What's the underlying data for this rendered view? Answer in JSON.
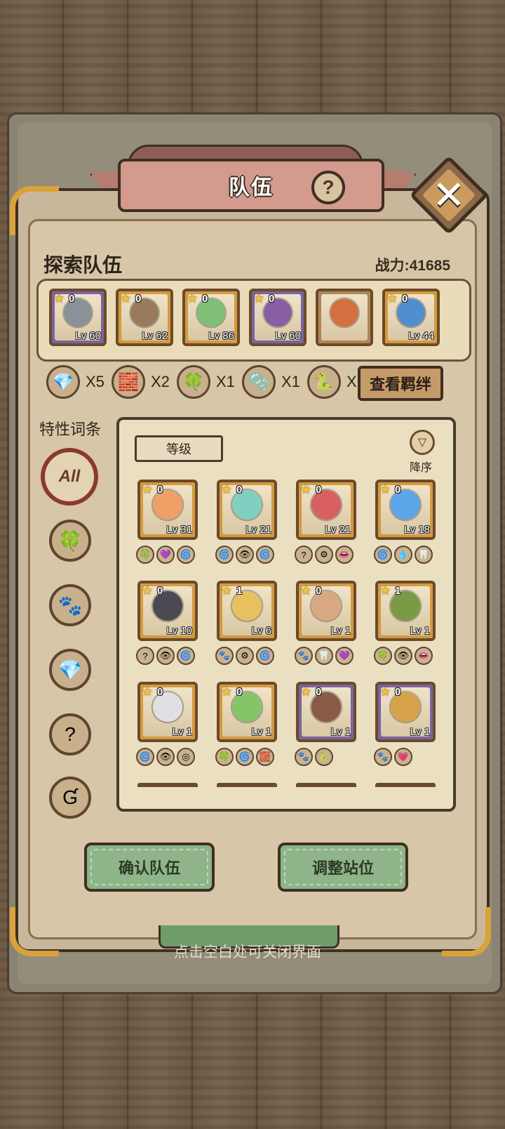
{
  "header": {
    "title": "队伍",
    "help_icon": "question-icon",
    "close_icon": "close-x-icon"
  },
  "team": {
    "title": "探索队伍",
    "power": "战力:41685",
    "members": [
      {
        "stars": "0",
        "level": "Lv 60",
        "frame": "purple",
        "color": "#8b9199"
      },
      {
        "stars": "0",
        "level": "Lv 62",
        "frame": "gold",
        "color": "#9a7a5c"
      },
      {
        "stars": "0",
        "level": "Lv 86",
        "frame": "gold",
        "color": "#7fbf76"
      },
      {
        "stars": "0",
        "level": "Lv 60",
        "frame": "purple",
        "color": "#8a5ea5"
      },
      {
        "stars": "",
        "level": "",
        "frame": "brown",
        "color": "#d4703f"
      },
      {
        "stars": "0",
        "level": "Lv 44",
        "frame": "gold",
        "color": "#4f8fd0"
      }
    ]
  },
  "bonds": {
    "items": [
      {
        "icon": "crystal-icon",
        "count": "X5"
      },
      {
        "icon": "blocks-icon",
        "count": "X2"
      },
      {
        "icon": "leaf-icon",
        "count": "X1"
      },
      {
        "icon": "slime-icon",
        "count": "X1"
      },
      {
        "icon": "worm-icon",
        "count": "X"
      }
    ],
    "view_button": "查看羁绊"
  },
  "filters": {
    "title": "特性词条",
    "items": [
      {
        "label": "All",
        "icon": "all-icon"
      },
      {
        "label": "",
        "icon": "leaf-icon"
      },
      {
        "label": "",
        "icon": "paw-icon"
      },
      {
        "label": "",
        "icon": "crystal-icon"
      },
      {
        "label": "?",
        "icon": "question-icon"
      },
      {
        "label": "",
        "icon": "g-rune-icon"
      }
    ]
  },
  "roster": {
    "sort_tab": "等级",
    "sort_order": "降序",
    "characters": [
      {
        "stars": "0",
        "level": "Lv 31",
        "frame": "gold",
        "color": "#f0a066",
        "traits": [
          "🍀",
          "💜",
          "🌀"
        ]
      },
      {
        "stars": "0",
        "level": "Lv 21",
        "frame": "gold",
        "color": "#7fd0c0",
        "traits": [
          "🌀",
          "👁",
          "🌀"
        ]
      },
      {
        "stars": "0",
        "level": "Lv 21",
        "frame": "gold",
        "color": "#d86060",
        "traits": [
          "?",
          "⚙",
          "👄"
        ]
      },
      {
        "stars": "0",
        "level": "Lv 18",
        "frame": "gold",
        "color": "#5aa6e8",
        "traits": [
          "🌀",
          "💧",
          "🦷"
        ]
      },
      {
        "stars": "0",
        "level": "Lv 10",
        "frame": "gold",
        "color": "#4a4a52",
        "traits": [
          "?",
          "👁",
          "🌀"
        ]
      },
      {
        "stars": "1",
        "level": "Lv 6",
        "frame": "gold",
        "color": "#e8c060",
        "traits": [
          "🐾",
          "⚙",
          "🌀"
        ]
      },
      {
        "stars": "0",
        "level": "Lv 1",
        "frame": "gold",
        "color": "#d9a882",
        "traits": [
          "🐾",
          "🦷",
          "💜"
        ]
      },
      {
        "stars": "1",
        "level": "Lv 1",
        "frame": "gold",
        "color": "#7a9a44",
        "traits": [
          "🍀",
          "👁",
          "👄"
        ]
      },
      {
        "stars": "0",
        "level": "Lv 1",
        "frame": "gold",
        "color": "#e0e0e4",
        "traits": [
          "🌀",
          "👁",
          "◎"
        ]
      },
      {
        "stars": "0",
        "level": "Lv 1",
        "frame": "gold",
        "color": "#86c46a",
        "traits": [
          "🍀",
          "🌀",
          "🧱"
        ]
      },
      {
        "stars": "0",
        "level": "Lv 1",
        "frame": "purple",
        "color": "#8a5a48",
        "traits": [
          "🐾",
          "🐍"
        ]
      },
      {
        "stars": "0",
        "level": "Lv 1",
        "frame": "purple",
        "color": "#d8a24a",
        "traits": [
          "🐾",
          "💗"
        ]
      }
    ]
  },
  "actions": {
    "confirm": "确认队伍",
    "adjust": "调整站位"
  },
  "hint": "点击空白处可关闭界面"
}
